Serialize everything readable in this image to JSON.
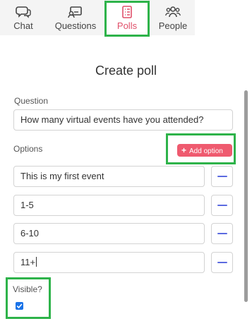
{
  "tabs": [
    {
      "label": "Chat",
      "icon": "chat-icon",
      "active": false
    },
    {
      "label": "Questions",
      "icon": "questions-icon",
      "active": false
    },
    {
      "label": "Polls",
      "icon": "polls-icon",
      "active": true
    },
    {
      "label": "People",
      "icon": "people-icon",
      "active": false
    }
  ],
  "poll": {
    "title": "Create poll",
    "question_label": "Question",
    "question_value": "How many virtual events have you attended?",
    "options_label": "Options",
    "add_option_label": "Add option",
    "options": [
      {
        "value": "This is my first event"
      },
      {
        "value": "1-5"
      },
      {
        "value": "6-10"
      },
      {
        "value": "11+"
      }
    ],
    "visible_label": "Visible?",
    "visible_checked": true
  },
  "colors": {
    "accent": "#ef5a6f",
    "active_tab": "#e0506a",
    "remove_icon": "#5b6ae0",
    "highlight": "#2eb34a",
    "checkbox": "#1a73e8"
  }
}
